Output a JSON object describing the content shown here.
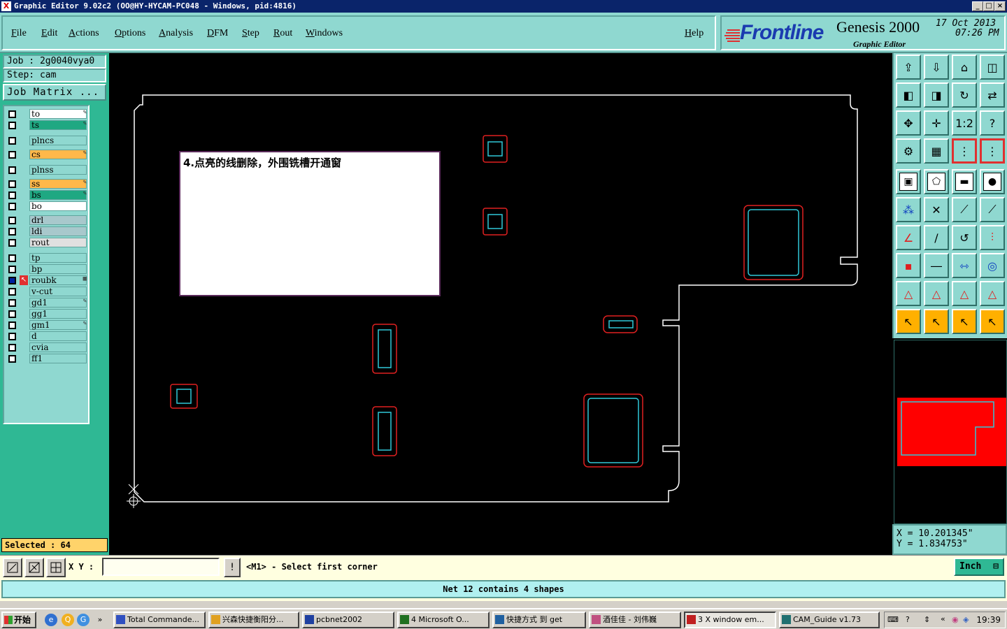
{
  "window": {
    "title": "Graphic Editor 9.02c2 (OO@HY-HYCAM-PC048 - Windows, pid:4816)",
    "icon": "x-app-icon"
  },
  "menu": {
    "items": [
      "File",
      "Edit",
      "Actions",
      "Options",
      "Analysis",
      "DFM",
      "Step",
      "Rout",
      "Windows"
    ],
    "help": "Help"
  },
  "brand": {
    "logo": "Frontline",
    "product": "Genesis 2000",
    "subtitle": "Graphic Editor",
    "date": "17 Oct 2013",
    "time": "07:26 PM"
  },
  "job": {
    "job_label": "Job : 2g0040vya0",
    "step_label": "Step: cam",
    "matrix_button": "Job Matrix ..."
  },
  "layers": [
    {
      "name": "to",
      "color": "#ffffff",
      "mark": "✎"
    },
    {
      "name": "ts",
      "color": "#1fa882",
      "mark": "✎"
    },
    {
      "name": "plncs",
      "color": "#8fd8d0",
      "mark": ""
    },
    {
      "name": "cs",
      "color": "#ffb84a",
      "mark": "✎"
    },
    {
      "name": "plnss",
      "color": "#8fd8d0",
      "mark": ""
    },
    {
      "name": "ss",
      "color": "#ffb84a",
      "mark": "✎"
    },
    {
      "name": "bs",
      "color": "#1fa882",
      "mark": "✎"
    },
    {
      "name": "bo",
      "color": "#ffffff",
      "mark": ""
    },
    {
      "name": "drl",
      "color": "#a8c8cc",
      "mark": ""
    },
    {
      "name": "ldi",
      "color": "#a8c8cc",
      "mark": ""
    },
    {
      "name": "rout",
      "color": "#e0e0e0",
      "mark": ""
    },
    {
      "name": "tp",
      "color": "#8fd8d0",
      "mark": ""
    },
    {
      "name": "bp",
      "color": "#8fd8d0",
      "mark": ""
    },
    {
      "name": "roubk",
      "color": "#8fd8d0",
      "mark": "▦"
    },
    {
      "name": "v-cut",
      "color": "#8fd8d0",
      "mark": ""
    },
    {
      "name": "gd1",
      "color": "#8fd8d0",
      "mark": "✎"
    },
    {
      "name": "gg1",
      "color": "#8fd8d0",
      "mark": ""
    },
    {
      "name": "gm1",
      "color": "#8fd8d0",
      "mark": "✎"
    },
    {
      "name": "d",
      "color": "#8fd8d0",
      "mark": ""
    },
    {
      "name": "cvia",
      "color": "#8fd8d0",
      "mark": ""
    },
    {
      "name": "ff1",
      "color": "#8fd8d0",
      "mark": ""
    }
  ],
  "selected_text": "Selected : 64",
  "note_text": "4.点亮的线删除，外围铣槽开通窗",
  "coords": {
    "x": "X  =  10.201345\"",
    "y": "Y  =  1.834753\""
  },
  "command": {
    "xy_label": "X Y :",
    "xy_value": "",
    "prompt": "<M1> - Select first corner",
    "unit": "Inch"
  },
  "status": "Net 12 contains 4 shapes",
  "taskbar": {
    "start": "开始",
    "tasks": [
      {
        "label": "Total Commande...",
        "icon_color": "#3050c0"
      },
      {
        "label": "兴森快捷衡阳分...",
        "icon_color": "#e0a020"
      },
      {
        "label": "pcbnet2002",
        "icon_color": "#2040a0"
      },
      {
        "label": "4 Microsoft O...",
        "icon_color": "#207020"
      },
      {
        "label": "快捷方式 到 get",
        "icon_color": "#2060a0"
      },
      {
        "label": "酒佳佳 - 刘伟巍",
        "icon_color": "#c05080"
      },
      {
        "label": "3 X window em...",
        "icon_color": "#c02020"
      },
      {
        "label": "CAM_Guide v1.73",
        "icon_color": "#207070"
      }
    ],
    "clock": "19:39"
  },
  "colors": {
    "panel": "#8fd8d0",
    "panel_dark": "#2fb894",
    "outline": "#ffffff",
    "pad_red": "#e02020",
    "pad_cyan": "#30c8d8",
    "minimap_fill": "#ff0000"
  }
}
